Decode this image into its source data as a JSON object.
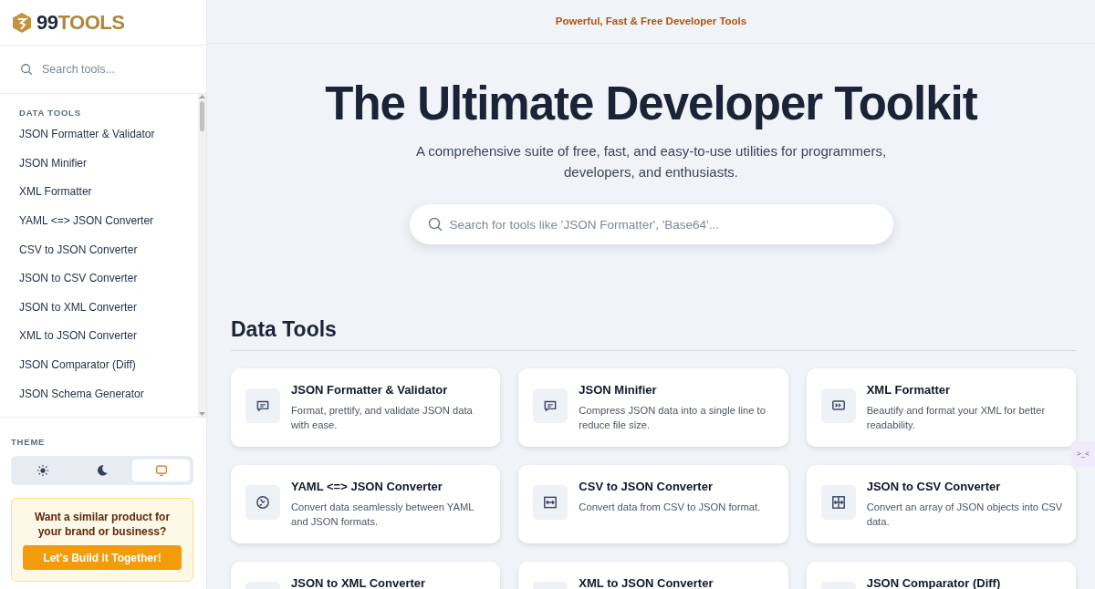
{
  "brand": {
    "digits": "99",
    "word": "TOOLS"
  },
  "sidebar": {
    "search": {
      "placeholder": "Search tools..."
    },
    "section": "DATA TOOLS",
    "items": [
      {
        "label": "JSON Formatter & Validator"
      },
      {
        "label": "JSON Minifier"
      },
      {
        "label": "XML Formatter"
      },
      {
        "label": "YAML <=> JSON Converter"
      },
      {
        "label": "CSV to JSON Converter"
      },
      {
        "label": "JSON to CSV Converter"
      },
      {
        "label": "JSON to XML Converter"
      },
      {
        "label": "XML to JSON Converter"
      },
      {
        "label": "JSON Comparator (Diff)"
      },
      {
        "label": "JSON Schema Generator"
      }
    ],
    "theme": {
      "label": "THEME",
      "options": [
        {
          "kind": "light",
          "selected": false
        },
        {
          "kind": "dark",
          "selected": false
        },
        {
          "kind": "system",
          "selected": true
        }
      ]
    },
    "promo": {
      "text": "Want a similar product for your brand or business?",
      "button": "Let's Build It Together!"
    }
  },
  "banner": "Powerful, Fast & Free Developer Tools",
  "hero": {
    "title": "The Ultimate Developer Toolkit",
    "subtitle": "A comprehensive suite of free, fast, and easy-to-use utilities for programmers, developers, and enthusiasts.",
    "search": {
      "placeholder": "Search for tools like 'JSON Formatter', 'Base64'..."
    }
  },
  "section": {
    "title": "Data Tools",
    "cards": [
      {
        "kind": "braces",
        "title": "JSON Formatter & Validator",
        "description": "Format, prettify, and validate JSON data with ease."
      },
      {
        "kind": "braces",
        "title": "JSON Minifier",
        "description": "Compress JSON data into a single line to reduce file size."
      },
      {
        "kind": "terminal",
        "title": "XML Formatter",
        "description": "Beautify and format your XML for better readability."
      },
      {
        "kind": "cycle",
        "title": "YAML <=> JSON Converter",
        "description": "Convert data seamlessly between YAML and JSON formats."
      },
      {
        "kind": "swap",
        "title": "CSV to JSON Converter",
        "description": "Convert data from CSV to JSON format."
      },
      {
        "kind": "split",
        "title": "JSON to CSV Converter",
        "description": "Convert an array of JSON objects into CSV data."
      },
      {
        "title": "JSON to XML Converter"
      },
      {
        "title": "XML to JSON Converter"
      },
      {
        "title": "JSON Comparator (Diff)"
      }
    ]
  },
  "side_widget": ">_<"
}
